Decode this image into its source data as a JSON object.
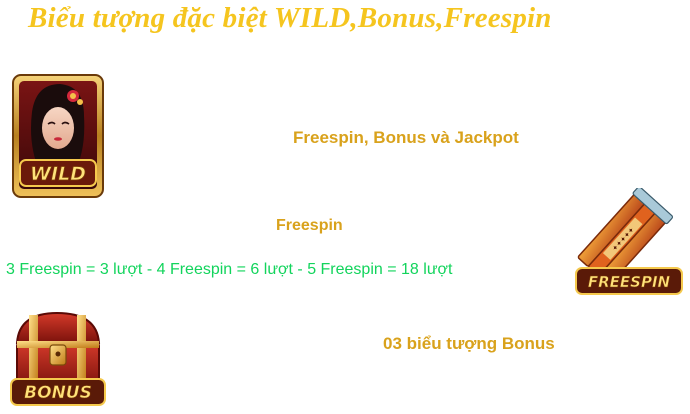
{
  "page": {
    "title": "Biểu tượng đặc biệt WILD,Bonus,Freespin"
  },
  "content": {
    "wild_line": "Freespin, Bonus và Jackpot",
    "freespin_heading": "Freespin",
    "freespin_rule": "3 Freespin = 3 lượt - 4 Freespin = 6 lượt - 5 Freespin = 18 lượt",
    "bonus_line": "03 biểu tượng Bonus"
  },
  "icons": {
    "wild": {
      "name": "wild-symbol-icon",
      "label": "WILD"
    },
    "freespin": {
      "name": "freespin-symbol-icon",
      "label": "FREESPIN"
    },
    "bonus": {
      "name": "bonus-symbol-icon",
      "label": "BONUS"
    }
  },
  "colors": {
    "title": "#f5c51f",
    "gold_text": "#d9a21c",
    "green_text": "#12d45c",
    "background": "#ffffff"
  }
}
